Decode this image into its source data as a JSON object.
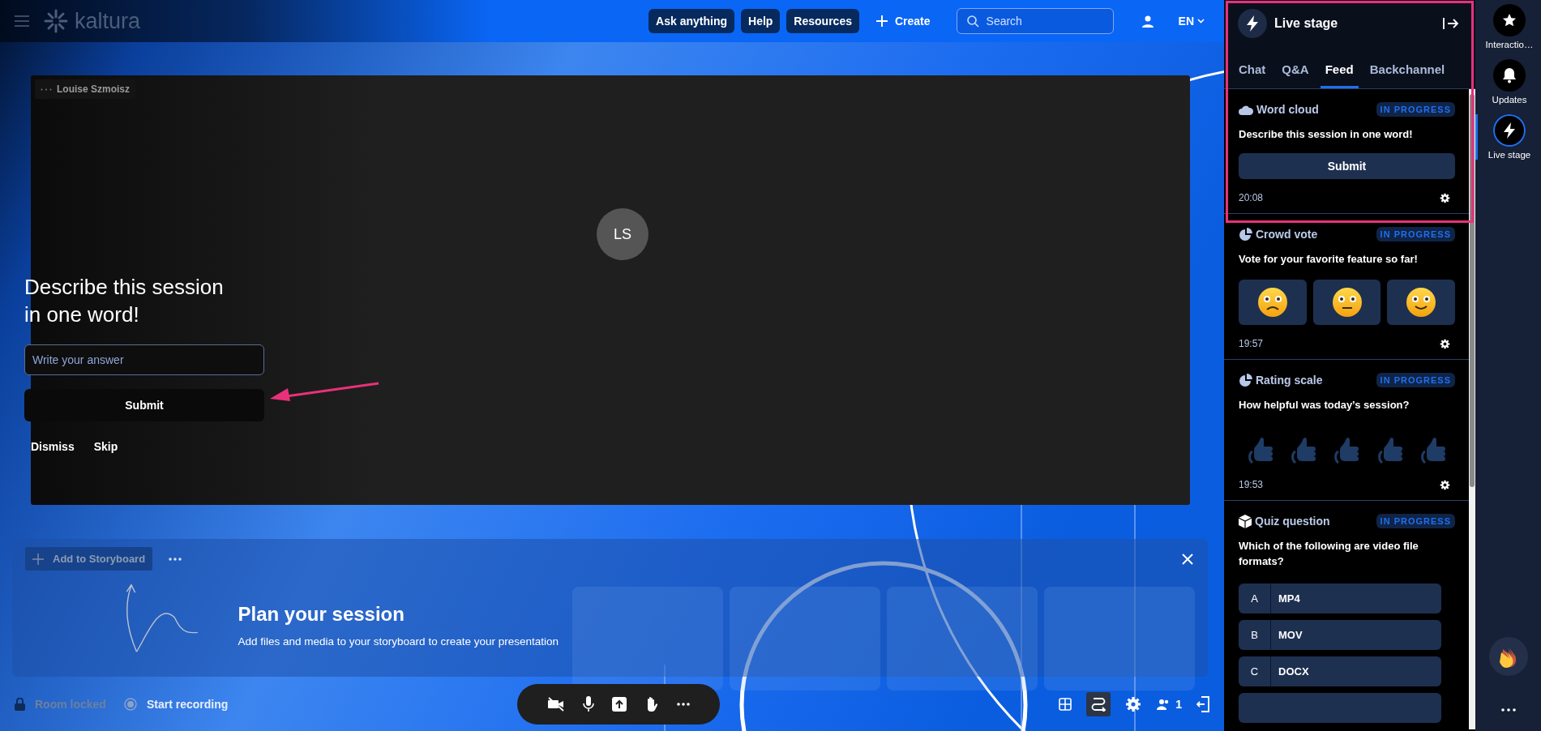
{
  "topbar": {
    "logo": "kaltura",
    "buttons": [
      "Ask anything",
      "Help",
      "Resources"
    ],
    "create": "Create",
    "search": {
      "placeholder": "Search"
    },
    "language": "EN"
  },
  "stage": {
    "participant": {
      "name": "Louise Szmoisz",
      "initials": "LS"
    },
    "prompt": {
      "question": "Describe this session in one word!",
      "input": {
        "placeholder": "Write your answer"
      },
      "submit": "Submit",
      "actions": [
        "Dismiss",
        "Skip"
      ]
    }
  },
  "storyboard": {
    "add": "Add to Storyboard",
    "title": "Plan your session",
    "subtitle": "Add files and media to your storyboard to create your presentation"
  },
  "controls": {
    "room": "Room locked",
    "record": "Start recording",
    "participants": "1"
  },
  "live_stage": {
    "title": "Live stage",
    "tabs": [
      {
        "label": "Chat",
        "selected": false
      },
      {
        "label": "Q&A",
        "selected": false
      },
      {
        "label": "Feed",
        "selected": true
      },
      {
        "label": "Backchannel",
        "selected": false
      }
    ],
    "cards": [
      {
        "kind": "word_cloud",
        "type": "Word cloud",
        "status": "IN PROGRESS",
        "question": "Describe this session in one word!",
        "submit": "Submit",
        "time": "20:08"
      },
      {
        "kind": "vote",
        "type": "Crowd vote",
        "status": "IN PROGRESS",
        "question": "Vote for your favorite feature so far!",
        "time": "19:57"
      },
      {
        "kind": "rating",
        "type": "Rating scale",
        "status": "IN PROGRESS",
        "question": "How helpful was today’s session?",
        "time": "19:53"
      },
      {
        "kind": "quiz",
        "type": "Quiz question",
        "status": "IN PROGRESS",
        "question": "Which of the following are video file formats?",
        "options": [
          {
            "letter": "A",
            "text": "MP4"
          },
          {
            "letter": "B",
            "text": "MOV"
          },
          {
            "letter": "C",
            "text": "DOCX"
          }
        ]
      }
    ]
  },
  "rail": [
    {
      "label": "Interactio…",
      "selected": false
    },
    {
      "label": "Updates",
      "selected": false
    },
    {
      "label": "Live stage",
      "selected": true
    }
  ]
}
